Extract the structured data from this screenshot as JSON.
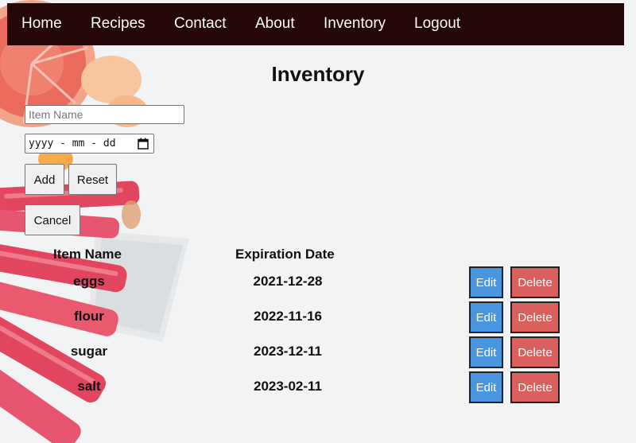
{
  "nav": {
    "items": [
      "Home",
      "Recipes",
      "Contact",
      "About",
      "Inventory",
      "Logout"
    ]
  },
  "page": {
    "title": "Inventory"
  },
  "form": {
    "name_placeholder": "Item Name",
    "name_value": "",
    "date_placeholder": "yyyy - mm - dd",
    "add_label": "Add",
    "reset_label": "Reset",
    "cancel_label": "Cancel",
    "calendar_icon": "calendar-icon"
  },
  "table": {
    "headers": [
      "Item Name",
      "Expiration Date"
    ],
    "rows": [
      {
        "name": "eggs",
        "date": "2021-12-28",
        "edit": "Edit",
        "delete": "Delete"
      },
      {
        "name": "flour",
        "date": "2022-11-16",
        "edit": "Edit",
        "delete": "Delete"
      },
      {
        "name": "sugar",
        "date": "2023-12-11",
        "edit": "Edit",
        "delete": "Delete"
      },
      {
        "name": "salt",
        "date": "2023-02-11",
        "edit": "Edit",
        "delete": "Delete"
      }
    ]
  },
  "colors": {
    "nav_bg": "#260707",
    "edit_bg": "#4a96de",
    "delete_bg": "#d9605c"
  }
}
